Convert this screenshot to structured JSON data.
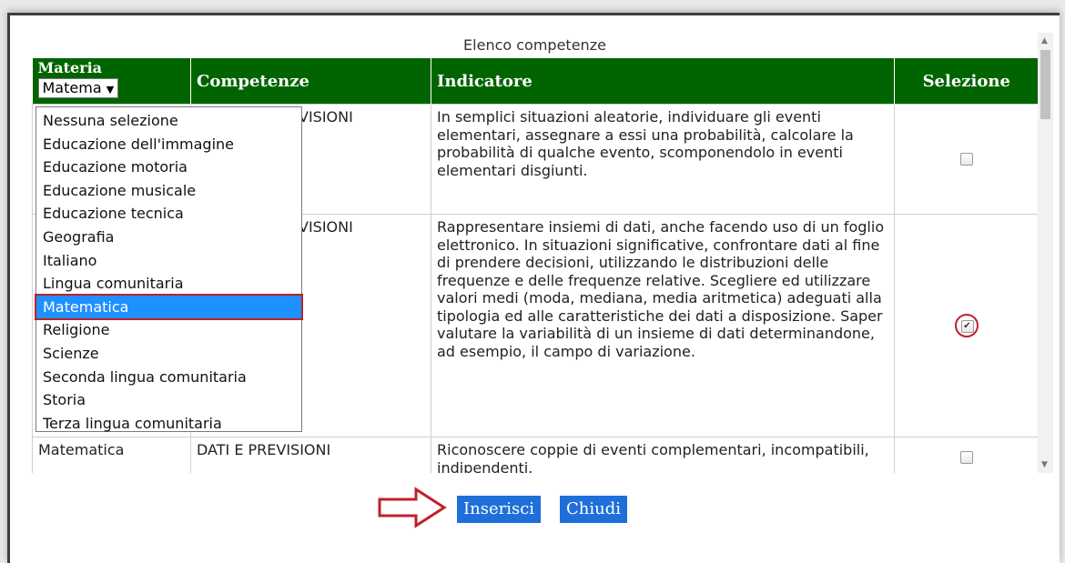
{
  "dialog": {
    "caption": "Elenco competenze"
  },
  "table": {
    "headers": {
      "materia": "Materia",
      "competenze": "Competenze",
      "indicatore": "Indicatore",
      "selezione": "Selezione"
    },
    "materia_select_value": "Matema",
    "rows": [
      {
        "materia": "",
        "competenza_visible": "VISIONI",
        "indicatore": "In semplici situazioni aleatorie, individuare gli eventi elementari, assegnare a essi una probabilità, calcolare la probabilità di qualche evento, scomponendolo in eventi elementari disgiunti.",
        "checked": false
      },
      {
        "materia": "",
        "competenza_visible": "VISIONI",
        "indicatore": "Rappresentare insiemi di dati, anche facendo uso di un foglio elettronico. In situazioni significative, confrontare dati al fine di prendere decisioni, utilizzando le distribuzioni delle frequenze e delle frequenze relative. Scegliere ed utilizzare valori medi (moda, mediana, media aritmetica) adeguati alla tipologia ed alle caratteristiche dei dati a disposizione. Saper valutare la variabilità di un insieme di dati determinandone, ad esempio, il campo di variazione.",
        "checked": true
      },
      {
        "materia": "Matematica",
        "competenza_visible": "DATI E PREVISIONI",
        "indicatore": "Riconoscere coppie di eventi complementari, incompatibili, indipendenti.",
        "checked": false
      }
    ]
  },
  "dropdown": {
    "options": [
      "Nessuna selezione",
      "Educazione dell'immagine",
      "Educazione motoria",
      "Educazione musicale",
      "Educazione tecnica",
      "Geografia",
      "Italiano",
      "Lingua comunitaria",
      "Matematica",
      "Religione",
      "Scienze",
      "Seconda lingua comunitaria",
      "Storia",
      "Terza lingua comunitaria"
    ],
    "selected_index": 8
  },
  "buttons": {
    "insert": "Inserisci",
    "close": "Chiudi"
  },
  "colors": {
    "header_bg": "#006400",
    "button_bg": "#1e6fd9",
    "highlight": "#1e90ff",
    "annotation": "#c0202a"
  },
  "icons": {
    "select_arrow": "triangle-down",
    "annotation_arrow": "arrow-right-outline"
  }
}
